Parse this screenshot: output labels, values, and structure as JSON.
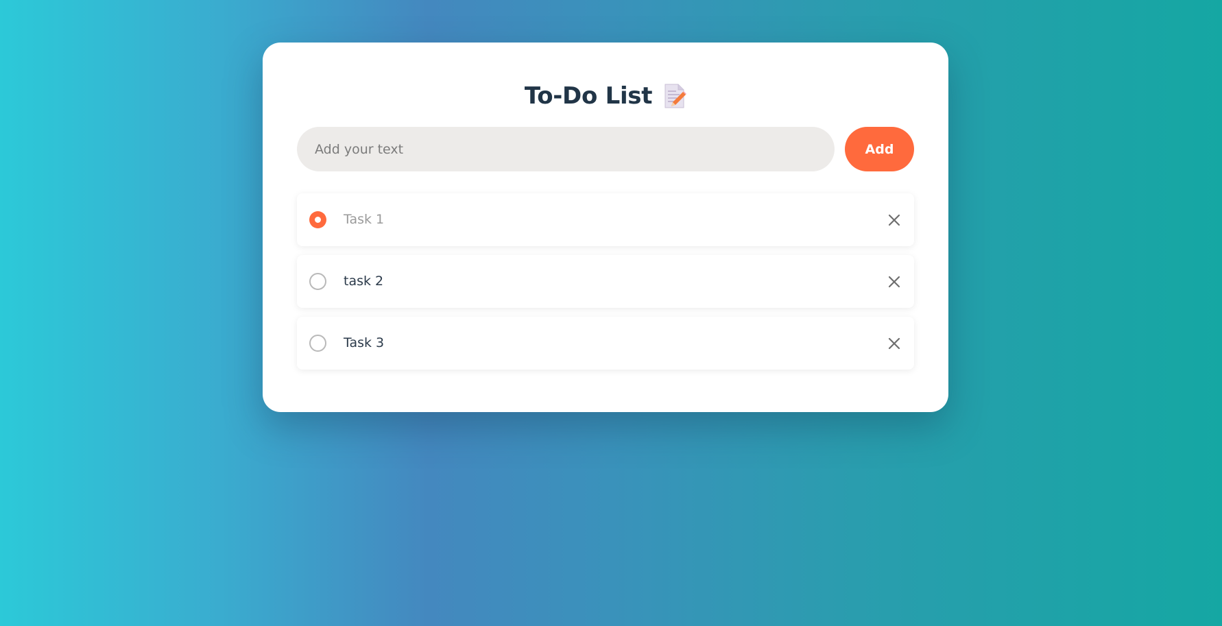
{
  "app": {
    "title": "To-Do List",
    "title_icon": "memo-icon"
  },
  "input": {
    "placeholder": "Add your text",
    "value": ""
  },
  "add_button": {
    "label": "Add"
  },
  "colors": {
    "accent": "#ff6a3d",
    "title": "#213547",
    "input_bg": "#edebe9",
    "card_bg": "#ffffff"
  },
  "tasks": [
    {
      "label": "Task 1",
      "checked": true
    },
    {
      "label": "task 2",
      "checked": false
    },
    {
      "label": "Task 3",
      "checked": false
    }
  ],
  "delete_icon": "close-icon"
}
